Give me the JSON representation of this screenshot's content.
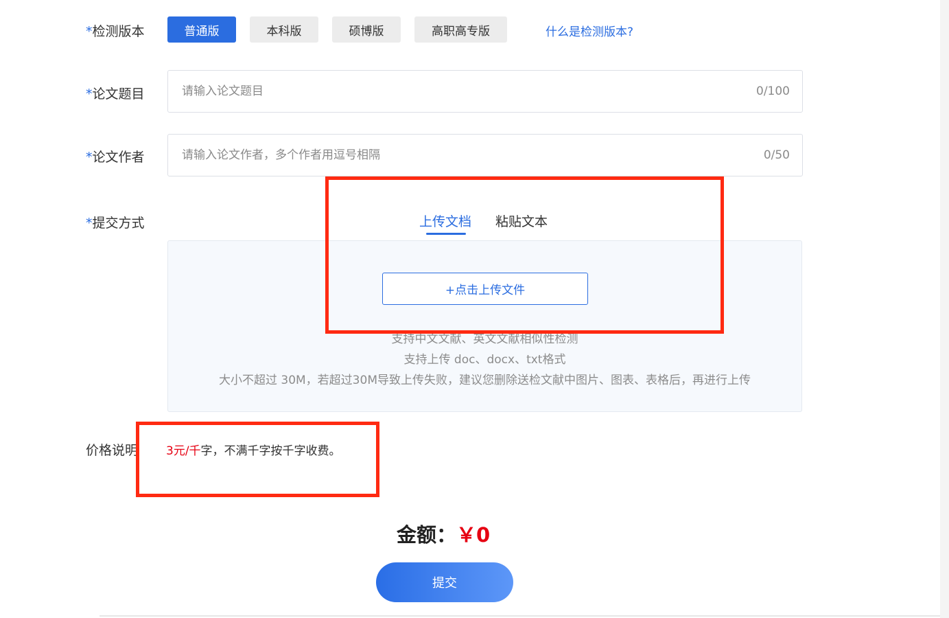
{
  "version_row": {
    "required_mark": "*",
    "label": "检测版本",
    "buttons": [
      {
        "label": "普通版",
        "active": true
      },
      {
        "label": "本科版",
        "active": false
      },
      {
        "label": "硕博版",
        "active": false
      },
      {
        "label": "高职高专版",
        "active": false
      }
    ],
    "help_link": "什么是检测版本?"
  },
  "title_row": {
    "required_mark": "*",
    "label": "论文题目",
    "placeholder": "请输入论文题目",
    "counter": "0/100"
  },
  "author_row": {
    "required_mark": "*",
    "label": "论文作者",
    "placeholder": "请输入论文作者，多个作者用逗号相隔",
    "counter": "0/50"
  },
  "submit_method": {
    "required_mark": "*",
    "label": "提交方式",
    "tabs": [
      {
        "label": "上传文档",
        "active": true
      },
      {
        "label": "粘贴文本",
        "active": false
      }
    ],
    "upload_button": "+点击上传文件",
    "notes": [
      "支持中文文献、英文文献相似性检测",
      "支持上传 doc、docx、txt格式",
      "大小不超过 30M，若超过30M导致上传失败，建议您删除送检文献中图片、图表、表格后，再进行上传"
    ]
  },
  "price": {
    "label": "价格说明",
    "rate": "3元/千",
    "rest": "字，不满千字按千字收费。"
  },
  "amount": {
    "label": "金额：",
    "value": "￥0"
  },
  "submit_button": "提交",
  "colors": {
    "accent": "#2b6de0",
    "highlight_box": "#ff2a12",
    "price_red": "#e60012"
  }
}
